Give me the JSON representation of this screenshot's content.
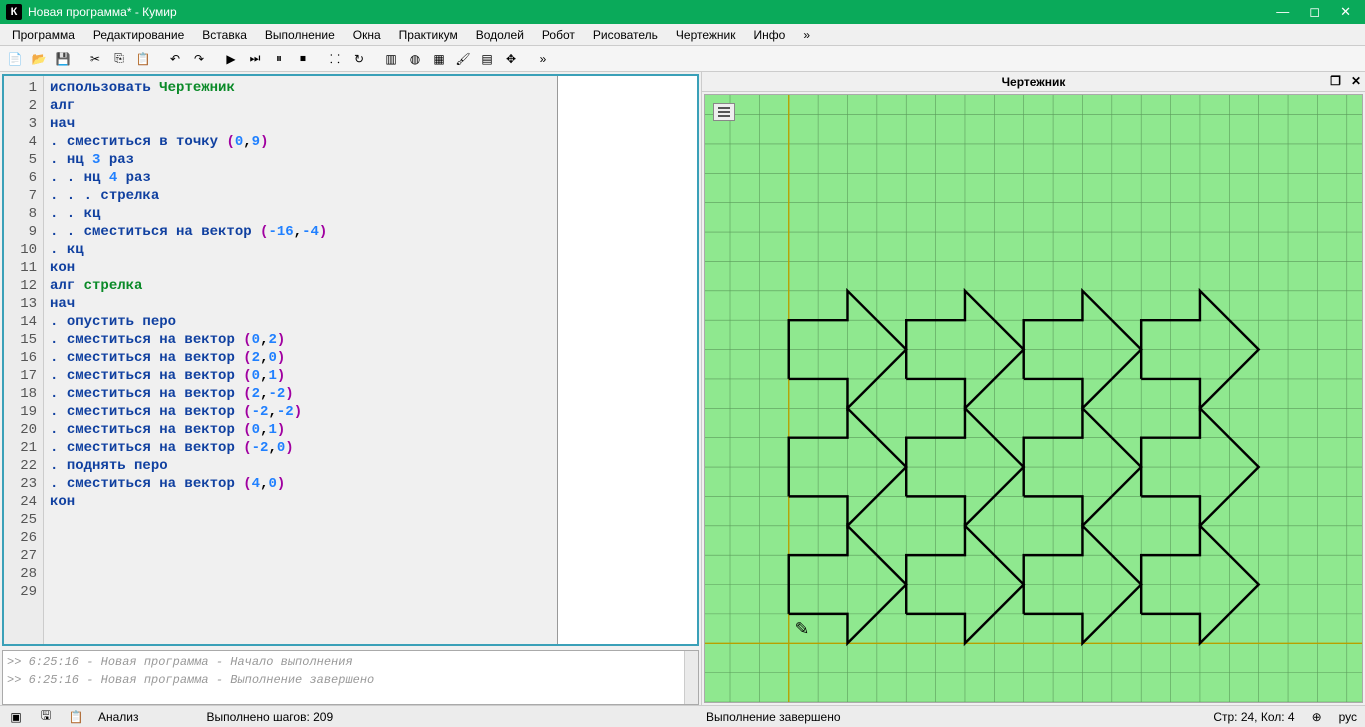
{
  "title": "Новая программа* - Кумир",
  "menus": [
    "Программа",
    "Редактирование",
    "Вставка",
    "Выполнение",
    "Окна",
    "Практикум",
    "Водолей",
    "Робот",
    "Рисователь",
    "Чертежник",
    "Инфо",
    "»"
  ],
  "toolbar_icons": [
    "new",
    "open",
    "save",
    "cut",
    "copy",
    "paste",
    "undo",
    "redo",
    "run",
    "step",
    "pause",
    "stop",
    "markers",
    "restart",
    "layout",
    "water",
    "grid",
    "brush",
    "stack",
    "move",
    "more"
  ],
  "code": [
    {
      "n": 1,
      "tokens": [
        {
          "t": "использовать",
          "c": "kw"
        },
        {
          "t": " "
        },
        {
          "t": "Чертежник",
          "c": "ident"
        }
      ]
    },
    {
      "n": 2,
      "tokens": [
        {
          "t": "алг",
          "c": "kw"
        }
      ]
    },
    {
      "n": 3,
      "tokens": [
        {
          "t": "нач",
          "c": "kw"
        }
      ]
    },
    {
      "n": 4,
      "tokens": [
        {
          "t": ". ",
          "c": "dot"
        },
        {
          "t": "сместиться в точку",
          "c": "kw"
        },
        {
          "t": " "
        },
        {
          "t": "(",
          "c": "paren"
        },
        {
          "t": "0",
          "c": "num"
        },
        {
          "t": ","
        },
        {
          "t": "9",
          "c": "num"
        },
        {
          "t": ")",
          "c": "paren"
        }
      ]
    },
    {
      "n": 5,
      "tokens": [
        {
          "t": ". ",
          "c": "dot"
        },
        {
          "t": "нц",
          "c": "kw"
        },
        {
          "t": " "
        },
        {
          "t": "3",
          "c": "num"
        },
        {
          "t": " "
        },
        {
          "t": "раз",
          "c": "kw"
        }
      ]
    },
    {
      "n": 6,
      "tokens": [
        {
          "t": ". . ",
          "c": "dot"
        },
        {
          "t": "нц",
          "c": "kw"
        },
        {
          "t": " "
        },
        {
          "t": "4",
          "c": "num"
        },
        {
          "t": " "
        },
        {
          "t": "раз",
          "c": "kw"
        }
      ]
    },
    {
      "n": 7,
      "tokens": [
        {
          "t": ". . . ",
          "c": "dot"
        },
        {
          "t": "стрелка",
          "c": "kw"
        }
      ]
    },
    {
      "n": 8,
      "tokens": [
        {
          "t": ". . ",
          "c": "dot"
        },
        {
          "t": "кц",
          "c": "kw"
        }
      ]
    },
    {
      "n": 9,
      "tokens": [
        {
          "t": ". . ",
          "c": "dot"
        },
        {
          "t": "сместиться на вектор",
          "c": "kw"
        },
        {
          "t": " "
        },
        {
          "t": "(",
          "c": "paren"
        },
        {
          "t": "-16",
          "c": "num"
        },
        {
          "t": ","
        },
        {
          "t": "-4",
          "c": "num"
        },
        {
          "t": ")",
          "c": "paren"
        }
      ]
    },
    {
      "n": 10,
      "tokens": [
        {
          "t": ". ",
          "c": "dot"
        },
        {
          "t": "кц",
          "c": "kw"
        }
      ]
    },
    {
      "n": 11,
      "tokens": [
        {
          "t": "кон",
          "c": "kw"
        }
      ]
    },
    {
      "n": 12,
      "tokens": [
        {
          "t": "алг",
          "c": "kw"
        },
        {
          "t": " "
        },
        {
          "t": "стрелка",
          "c": "ident"
        }
      ]
    },
    {
      "n": 13,
      "tokens": [
        {
          "t": "нач",
          "c": "kw"
        }
      ]
    },
    {
      "n": 14,
      "tokens": [
        {
          "t": ". ",
          "c": "dot"
        },
        {
          "t": "опустить перо",
          "c": "kw"
        }
      ]
    },
    {
      "n": 15,
      "tokens": [
        {
          "t": ". ",
          "c": "dot"
        },
        {
          "t": "сместиться на вектор",
          "c": "kw"
        },
        {
          "t": " "
        },
        {
          "t": "(",
          "c": "paren"
        },
        {
          "t": "0",
          "c": "num"
        },
        {
          "t": ","
        },
        {
          "t": "2",
          "c": "num"
        },
        {
          "t": ")",
          "c": "paren"
        }
      ]
    },
    {
      "n": 16,
      "tokens": [
        {
          "t": ". ",
          "c": "dot"
        },
        {
          "t": "сместиться на вектор",
          "c": "kw"
        },
        {
          "t": " "
        },
        {
          "t": "(",
          "c": "paren"
        },
        {
          "t": "2",
          "c": "num"
        },
        {
          "t": ","
        },
        {
          "t": "0",
          "c": "num"
        },
        {
          "t": ")",
          "c": "paren"
        }
      ]
    },
    {
      "n": 17,
      "tokens": [
        {
          "t": ". ",
          "c": "dot"
        },
        {
          "t": "сместиться на вектор",
          "c": "kw"
        },
        {
          "t": " "
        },
        {
          "t": "(",
          "c": "paren"
        },
        {
          "t": "0",
          "c": "num"
        },
        {
          "t": ","
        },
        {
          "t": "1",
          "c": "num"
        },
        {
          "t": ")",
          "c": "paren"
        }
      ]
    },
    {
      "n": 18,
      "tokens": [
        {
          "t": ". ",
          "c": "dot"
        },
        {
          "t": "сместиться на вектор",
          "c": "kw"
        },
        {
          "t": " "
        },
        {
          "t": "(",
          "c": "paren"
        },
        {
          "t": "2",
          "c": "num"
        },
        {
          "t": ","
        },
        {
          "t": "-2",
          "c": "num"
        },
        {
          "t": ")",
          "c": "paren"
        }
      ]
    },
    {
      "n": 19,
      "tokens": [
        {
          "t": ". ",
          "c": "dot"
        },
        {
          "t": "сместиться на вектор",
          "c": "kw"
        },
        {
          "t": " "
        },
        {
          "t": "(",
          "c": "paren"
        },
        {
          "t": "-2",
          "c": "num"
        },
        {
          "t": ","
        },
        {
          "t": "-2",
          "c": "num"
        },
        {
          "t": ")",
          "c": "paren"
        }
      ]
    },
    {
      "n": 20,
      "tokens": [
        {
          "t": ". ",
          "c": "dot"
        },
        {
          "t": "сместиться на вектор",
          "c": "kw"
        },
        {
          "t": " "
        },
        {
          "t": "(",
          "c": "paren"
        },
        {
          "t": "0",
          "c": "num"
        },
        {
          "t": ","
        },
        {
          "t": "1",
          "c": "num"
        },
        {
          "t": ")",
          "c": "paren"
        }
      ]
    },
    {
      "n": 21,
      "tokens": [
        {
          "t": ". ",
          "c": "dot"
        },
        {
          "t": "сместиться на вектор",
          "c": "kw"
        },
        {
          "t": " "
        },
        {
          "t": "(",
          "c": "paren"
        },
        {
          "t": "-2",
          "c": "num"
        },
        {
          "t": ","
        },
        {
          "t": "0",
          "c": "num"
        },
        {
          "t": ")",
          "c": "paren"
        }
      ]
    },
    {
      "n": 22,
      "tokens": [
        {
          "t": ". ",
          "c": "dot"
        },
        {
          "t": "поднять перо",
          "c": "kw"
        }
      ]
    },
    {
      "n": 23,
      "tokens": [
        {
          "t": ". ",
          "c": "dot"
        },
        {
          "t": "сместиться на вектор",
          "c": "kw"
        },
        {
          "t": " "
        },
        {
          "t": "(",
          "c": "paren"
        },
        {
          "t": "4",
          "c": "num"
        },
        {
          "t": ","
        },
        {
          "t": "0",
          "c": "num"
        },
        {
          "t": ")",
          "c": "paren"
        }
      ]
    },
    {
      "n": 24,
      "tokens": [
        {
          "t": "кон",
          "c": "kw"
        }
      ]
    },
    {
      "n": 25,
      "tokens": []
    },
    {
      "n": 26,
      "tokens": []
    },
    {
      "n": 27,
      "tokens": []
    },
    {
      "n": 28,
      "tokens": []
    },
    {
      "n": 29,
      "tokens": []
    }
  ],
  "console": [
    ">>  6:25:16 - Новая программа - Начало выполнения",
    ">>  6:25:16 - Новая программа - Выполнение завершено"
  ],
  "drawer_title": "Чертежник",
  "status": {
    "analysis": "Анализ",
    "steps": "Выполнено шагов: 209",
    "done": "Выполнение завершено",
    "pos": "Стр: 24, Кол: 4",
    "lang": "рус"
  },
  "chart_data": {
    "type": "vector-drawing",
    "grid_cells": 20,
    "start": [
      0,
      9
    ],
    "rows": 3,
    "cols": 4,
    "row_offset": [
      -16,
      -4
    ],
    "arrow_advance": [
      4,
      0
    ],
    "arrow_vectors": [
      [
        0,
        2
      ],
      [
        2,
        0
      ],
      [
        0,
        1
      ],
      [
        2,
        -2
      ],
      [
        -2,
        -2
      ],
      [
        0,
        1
      ],
      [
        -2,
        0
      ]
    ]
  }
}
